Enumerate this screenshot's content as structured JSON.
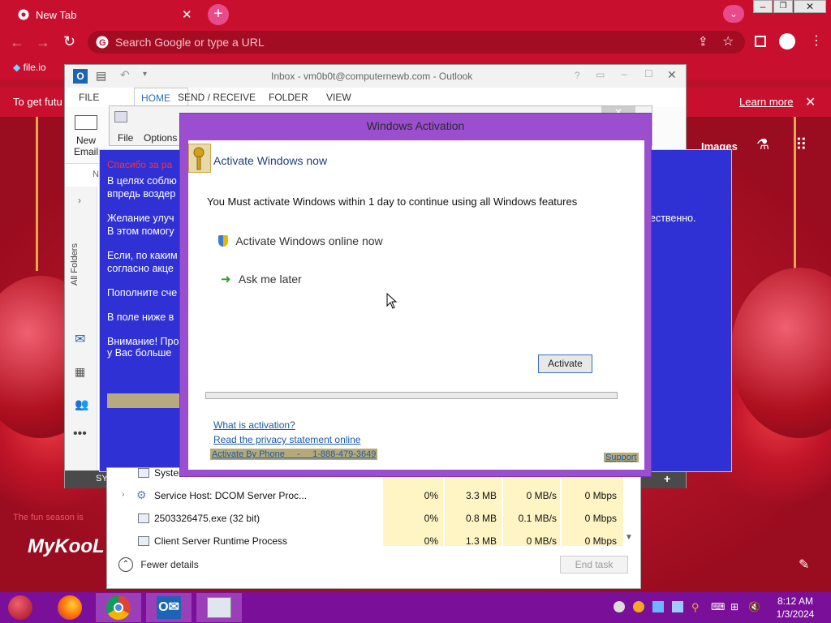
{
  "chrome": {
    "tab_title": "New Tab",
    "omnibox_placeholder": "Search Google or type a URL",
    "bookmark": "file.io",
    "infobar_text": "To get futu",
    "infobar_link": "Learn more",
    "images_link": "Images",
    "wallpaper_caption": "The fun season is",
    "brand": "MyKooL"
  },
  "outlook": {
    "title": "Inbox - vm0b0t@computernewb.com - Outlook",
    "tabs": [
      "FILE",
      "HOME",
      "SEND / RECEIVE",
      "FOLDER",
      "VIEW"
    ],
    "new_email": "New Email",
    "new_email_line1": "New",
    "new_email_line2": "Email",
    "n_label": "N",
    "all_folders": "All Folders",
    "status_left": "SY"
  },
  "inner_window": {
    "menu": [
      "File",
      "Options"
    ]
  },
  "blue_window": {
    "heading": "Спасибо за ра",
    "paragraphs": [
      "В целях соблю",
      "впредь воздер",
      "Желание улуч",
      "В этом помогу",
      "Если, по каким",
      "согласно акце",
      "Пополните сче",
      "В поле ниже в",
      "Внимание! Про",
      "у Вас больше"
    ],
    "right_text": "ественно."
  },
  "taskmgr": {
    "rows": [
      {
        "name": "Syster",
        "cpu": "",
        "mem": "",
        "disk": "",
        "net": ""
      },
      {
        "name": "Service Host: DCOM Server Proc...",
        "cpu": "0%",
        "mem": "3.3 MB",
        "disk": "0 MB/s",
        "net": "0 Mbps"
      },
      {
        "name": "2503326475.exe (32 bit)",
        "cpu": "0%",
        "mem": "0.8 MB",
        "disk": "0.1 MB/s",
        "net": "0 Mbps"
      },
      {
        "name": "Client Server Runtime Process",
        "cpu": "0%",
        "mem": "1.3 MB",
        "disk": "0 MB/s",
        "net": "0 Mbps"
      }
    ],
    "fewer_details": "Fewer details",
    "end_task": "End task"
  },
  "activation": {
    "window_title": "Windows Activation",
    "header": "Activate Windows now",
    "message": "You Must activate Windows within 1 day to continue using all Windows features",
    "option_online": "Activate Windows online now",
    "option_later": "Ask me later",
    "activate_button": "Activate",
    "progress": 0,
    "link_what": "What is activation?",
    "link_privacy": "Read the privacy statement online",
    "link_phone": "Activate By Phone     -     1-888-479-3649",
    "support": "Support"
  },
  "taskbar": {
    "time": "8:12 AM",
    "date": "1/3/2024"
  },
  "colors": {
    "chrome_red": "#c8102e",
    "taskbar_purple": "#7a0f9a",
    "dialog_purple": "#9b4fcf",
    "blue_window": "#2f31d4",
    "link_blue": "#1a5aa8"
  }
}
